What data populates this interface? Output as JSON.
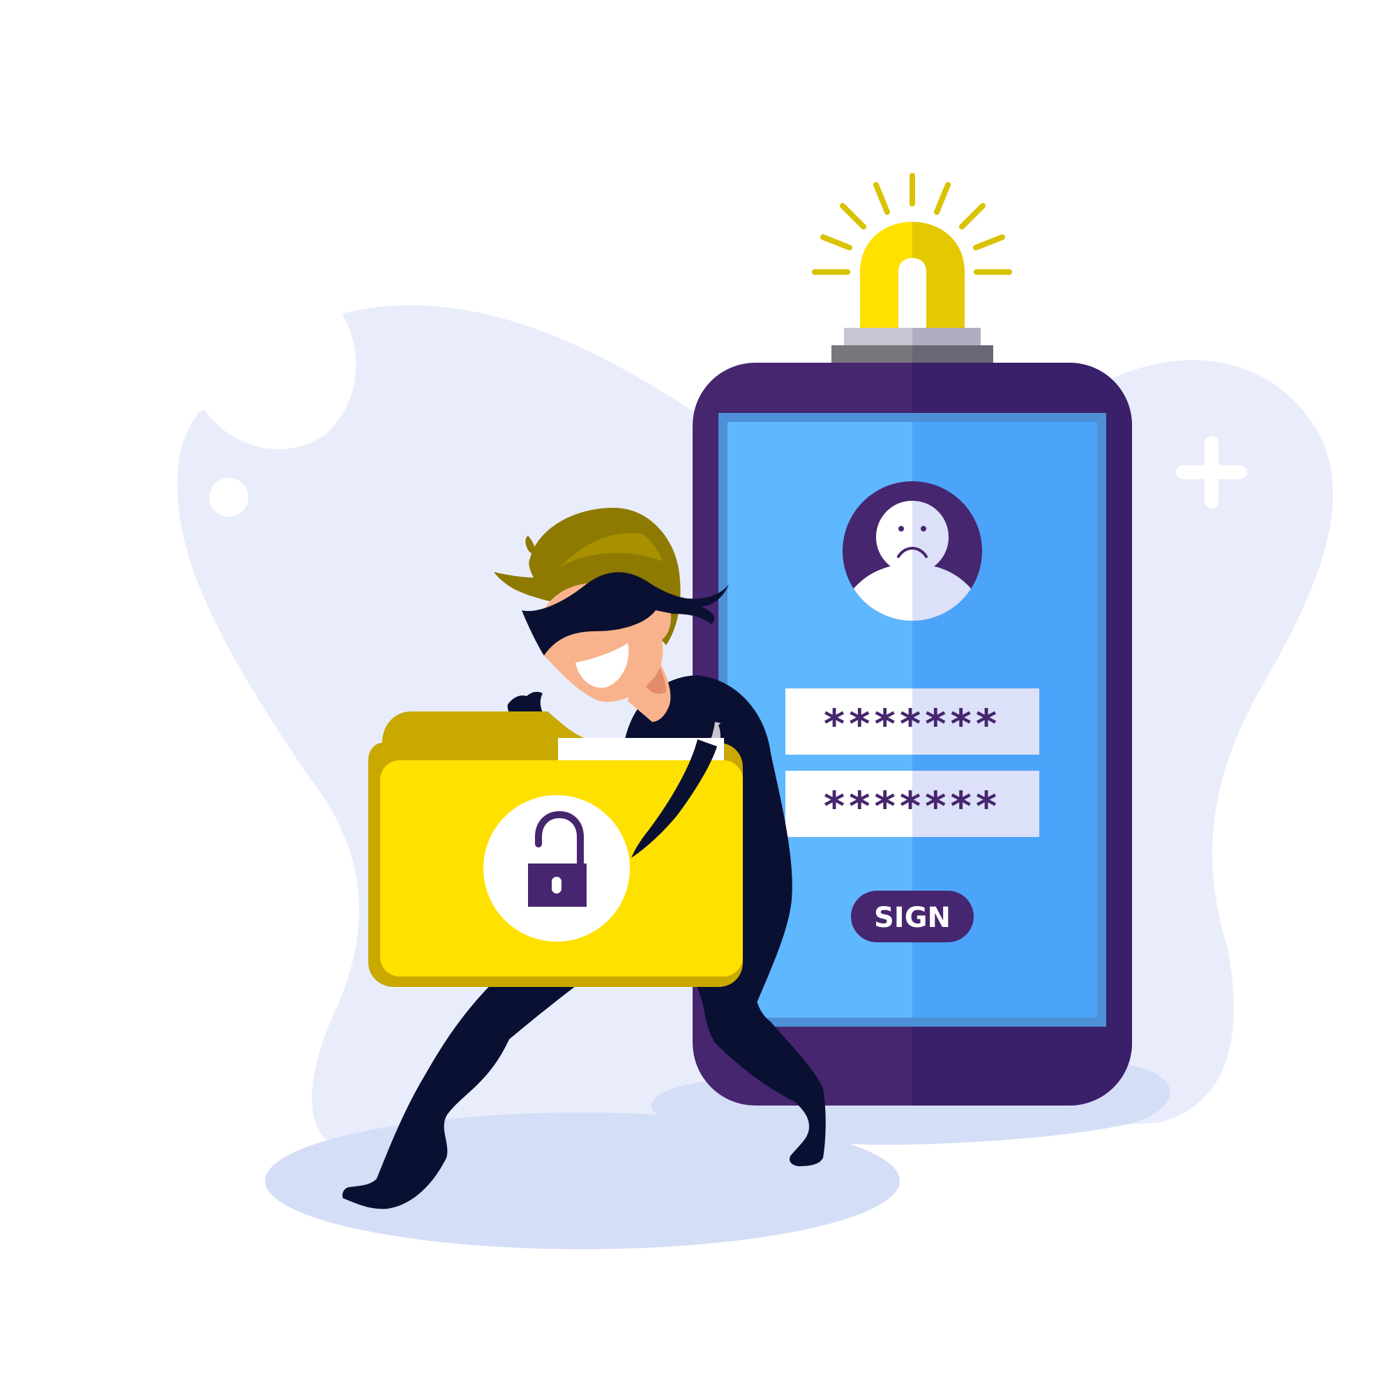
{
  "phone": {
    "password_field_1": "*******",
    "password_field_2": "*******",
    "sign_button_label": "SIGN"
  },
  "icons": {
    "alarm": "alarm-light-icon",
    "sad_user": "sad-user-icon",
    "padlock": "unlocked-padlock-icon",
    "plus": "plus-icon"
  },
  "colors": {
    "background_blob": "#E9EDFB",
    "ground_shadow": "#D5DEF7",
    "phone_body": "#46266E",
    "phone_body_shade": "#3A1F6A",
    "screen_left": "#5FB7FD",
    "screen_right": "#4BA3FA",
    "alarm_light": "#FFE100",
    "alarm_light_shade": "#E4C800",
    "folder": "#FFE100",
    "folder_back": "#C9A800",
    "thief_suit": "#0A1032",
    "thief_skin": "#F8B38C",
    "thief_hair": "#8E7A00",
    "accent_purple": "#46266E",
    "field_bg": "#FFFFFF",
    "field_bg_shade": "#DCE0F8"
  }
}
